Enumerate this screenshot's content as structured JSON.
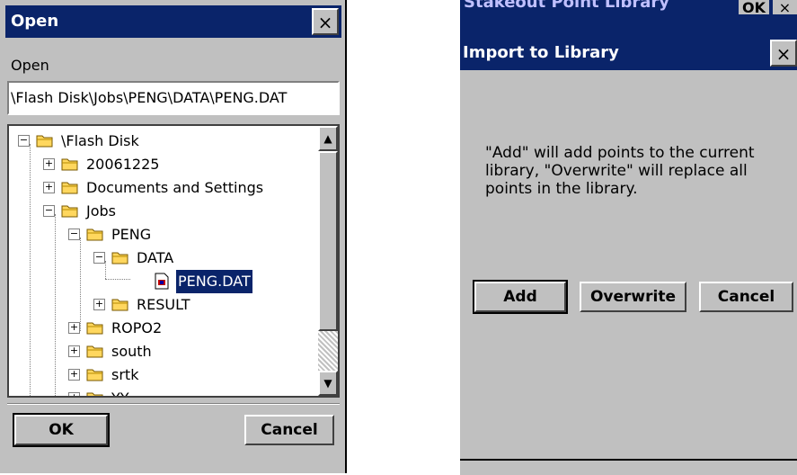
{
  "open_dialog": {
    "title": "Open",
    "close_label": "×",
    "subtitle": "Open",
    "path": "\\Flash Disk\\Jobs\\PENG\\DATA\\PENG.DAT",
    "tree": {
      "items": [
        {
          "label": "\\Flash Disk",
          "expander": "−",
          "icon": "folder-icon"
        },
        {
          "label": "20061225",
          "expander": "+",
          "icon": "folder-icon"
        },
        {
          "label": "Documents and Settings",
          "expander": "+",
          "icon": "folder-icon"
        },
        {
          "label": "Jobs",
          "expander": "−",
          "icon": "folder-icon"
        },
        {
          "label": "PENG",
          "expander": "−",
          "icon": "folder-icon"
        },
        {
          "label": "DATA",
          "expander": "−",
          "icon": "folder-icon"
        },
        {
          "label": "PENG.DAT",
          "expander": "",
          "icon": "file-icon",
          "selected": true
        },
        {
          "label": "RESULT",
          "expander": "+",
          "icon": "folder-icon"
        },
        {
          "label": "ROPO2",
          "expander": "+",
          "icon": "folder-icon"
        },
        {
          "label": "south",
          "expander": "+",
          "icon": "folder-icon"
        },
        {
          "label": "srtk",
          "expander": "+",
          "icon": "folder-icon"
        },
        {
          "label": "YY",
          "expander": "+",
          "icon": "folder-icon"
        }
      ]
    },
    "scroll_up": "▲",
    "scroll_down": "▼",
    "ok_label": "OK",
    "cancel_label": "Cancel"
  },
  "import_dialog": {
    "background_title": "Stakeout Point Library",
    "background_ok": "OK",
    "background_close": "×",
    "title": "Import to Library",
    "close_label": "×",
    "message": "\"Add\" will add points to the current library, \"Overwrite\" will replace all points in the library.",
    "add_label": "Add",
    "overwrite_label": "Overwrite",
    "cancel_label": "Cancel"
  },
  "colors": {
    "titlebar": "#0a246a",
    "window": "#c0c0c0",
    "selection": "#0a246a"
  }
}
